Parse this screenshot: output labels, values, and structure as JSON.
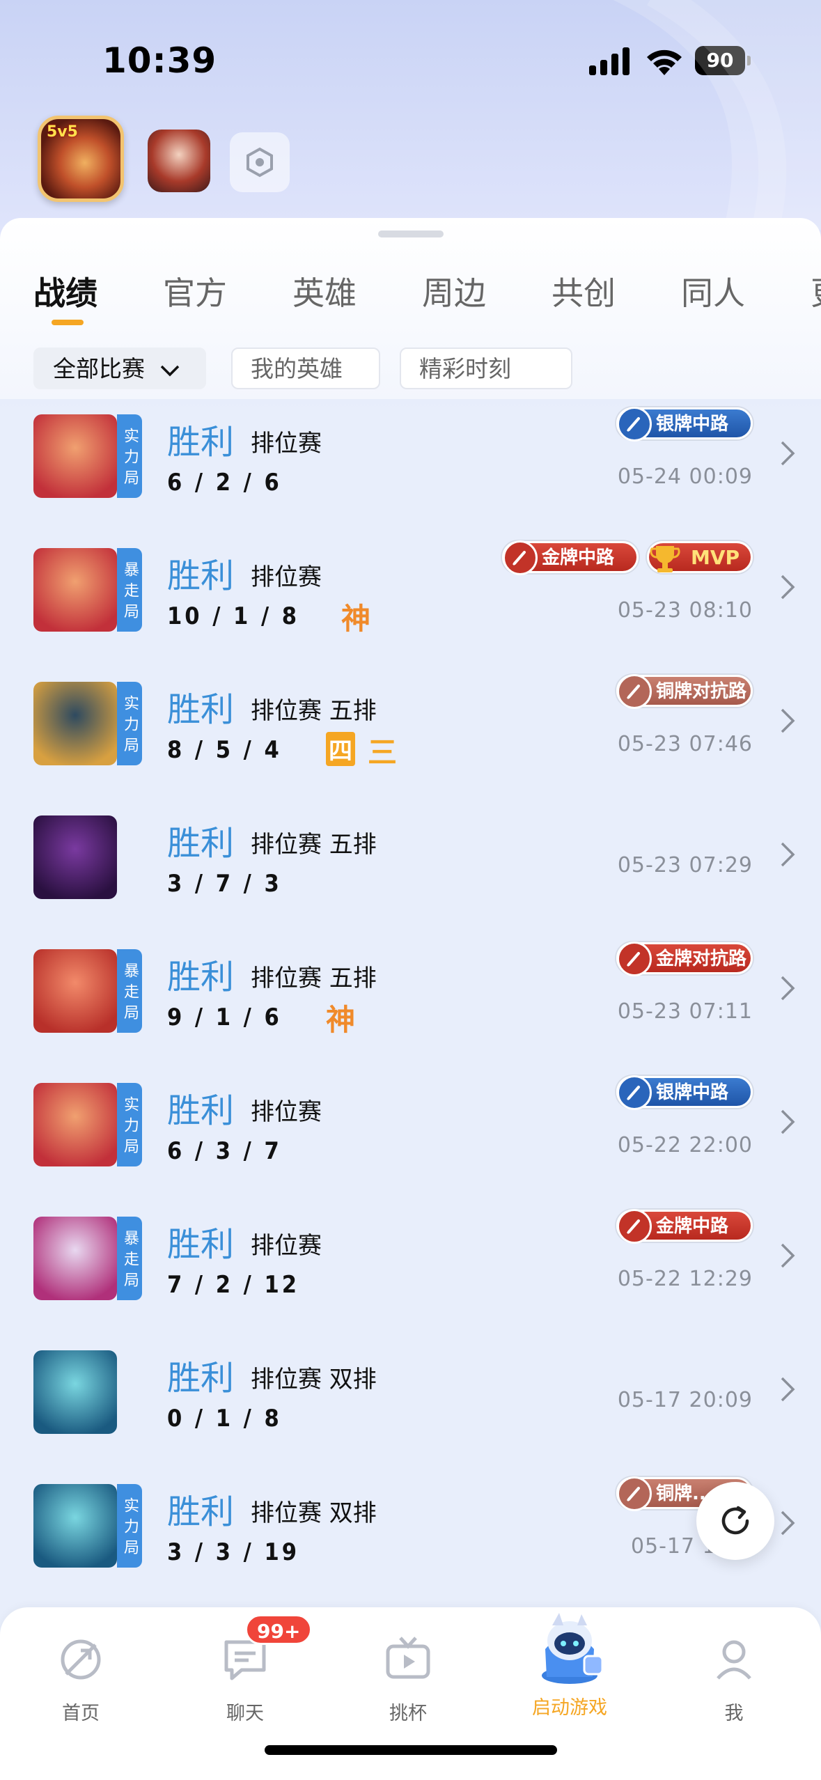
{
  "status_bar": {
    "time": "10:39",
    "battery": "90"
  },
  "game_row": {
    "main_game_badge": "5v5"
  },
  "tabs": [
    {
      "label": "战绩",
      "active": true
    },
    {
      "label": "官方"
    },
    {
      "label": "英雄"
    },
    {
      "label": "周边"
    },
    {
      "label": "共创"
    },
    {
      "label": "同人"
    },
    {
      "label": "更"
    }
  ],
  "filters": [
    {
      "label": "全部比赛",
      "active": true
    },
    {
      "label": "我的英雄"
    },
    {
      "label": "精彩时刻"
    }
  ],
  "matches": [
    {
      "mode_tag": "实力局",
      "result": "胜利",
      "match_type": "排位赛",
      "kda": "6 / 2 / 6",
      "honors": [],
      "badges": [
        {
          "type": "silver",
          "label": "银牌中路"
        }
      ],
      "time": "05-24 00:09",
      "avatar_colors": [
        "#f0a070",
        "#c2303a"
      ]
    },
    {
      "mode_tag": "暴走局",
      "result": "胜利",
      "match_type": "排位赛",
      "kda": "10 / 1 / 8",
      "honors": [
        {
          "label": "神",
          "kind": "shen"
        }
      ],
      "badges": [
        {
          "type": "gold",
          "label": "金牌中路"
        },
        {
          "type": "mvp",
          "label": "MVP"
        }
      ],
      "time": "05-23 08:10",
      "avatar_colors": [
        "#f0a070",
        "#c2303a"
      ]
    },
    {
      "mode_tag": "实力局",
      "result": "胜利",
      "match_type": "排位赛 五排",
      "kda": "8 / 5 / 4",
      "honors": [
        {
          "label": "四",
          "kind": "box"
        },
        {
          "label": "三",
          "kind": "plain"
        }
      ],
      "badges": [
        {
          "type": "bronze",
          "label": "铜牌对抗路"
        }
      ],
      "time": "05-23 07:46",
      "avatar_colors": [
        "#2e4a60",
        "#d8a040"
      ]
    },
    {
      "mode_tag": "",
      "result": "胜利",
      "match_type": "排位赛 五排",
      "kda": "3 / 7 / 3",
      "honors": [],
      "badges": [],
      "time": "05-23 07:29",
      "avatar_colors": [
        "#7a3aa0",
        "#2a1040"
      ]
    },
    {
      "mode_tag": "暴走局",
      "result": "胜利",
      "match_type": "排位赛 五排",
      "kda": "9 / 1 / 6",
      "honors": [
        {
          "label": "神",
          "kind": "shen"
        }
      ],
      "badges": [
        {
          "type": "gold",
          "label": "金牌对抗路"
        }
      ],
      "time": "05-23 07:11",
      "avatar_colors": [
        "#f28a6a",
        "#b8302a"
      ]
    },
    {
      "mode_tag": "实力局",
      "result": "胜利",
      "match_type": "排位赛",
      "kda": "6 / 3 / 7",
      "honors": [],
      "badges": [
        {
          "type": "silver",
          "label": "银牌中路"
        }
      ],
      "time": "05-22 22:00",
      "avatar_colors": [
        "#f0a070",
        "#c2303a"
      ]
    },
    {
      "mode_tag": "暴走局",
      "result": "胜利",
      "match_type": "排位赛",
      "kda": "7 / 2 / 12",
      "honors": [],
      "badges": [
        {
          "type": "gold",
          "label": "金牌中路"
        }
      ],
      "time": "05-22 12:29",
      "avatar_colors": [
        "#e8d8f0",
        "#b0307a"
      ]
    },
    {
      "mode_tag": "",
      "result": "胜利",
      "match_type": "排位赛 双排",
      "kda": "0 / 1 / 8",
      "honors": [],
      "badges": [],
      "time": "05-17 20:09",
      "avatar_colors": [
        "#7ad6e0",
        "#1a5a80"
      ]
    },
    {
      "mode_tag": "实力局",
      "result": "胜利",
      "match_type": "排位赛 双排",
      "kda": "3 / 3 / 19",
      "honors": [],
      "badges": [
        {
          "type": "bronze",
          "label": "铜牌..."
        }
      ],
      "time": "05-17 19:..",
      "avatar_colors": [
        "#7ad6e0",
        "#1a5a80"
      ]
    }
  ],
  "bottom_nav": {
    "items": [
      {
        "label": "首页",
        "icon": "compass-icon"
      },
      {
        "label": "聊天",
        "icon": "chat-icon"
      },
      {
        "label": "挑杯",
        "icon": "tv-icon"
      },
      {
        "label": "启动游戏",
        "icon": "mascot-icon",
        "highlight": true
      },
      {
        "label": "我",
        "icon": "person-icon"
      }
    ],
    "chat_badge": "99+"
  },
  "colors": {
    "accent": "#f5a623",
    "win_blue": "#3a8fd8",
    "mode_tag_blue": "#3f8fe0"
  }
}
